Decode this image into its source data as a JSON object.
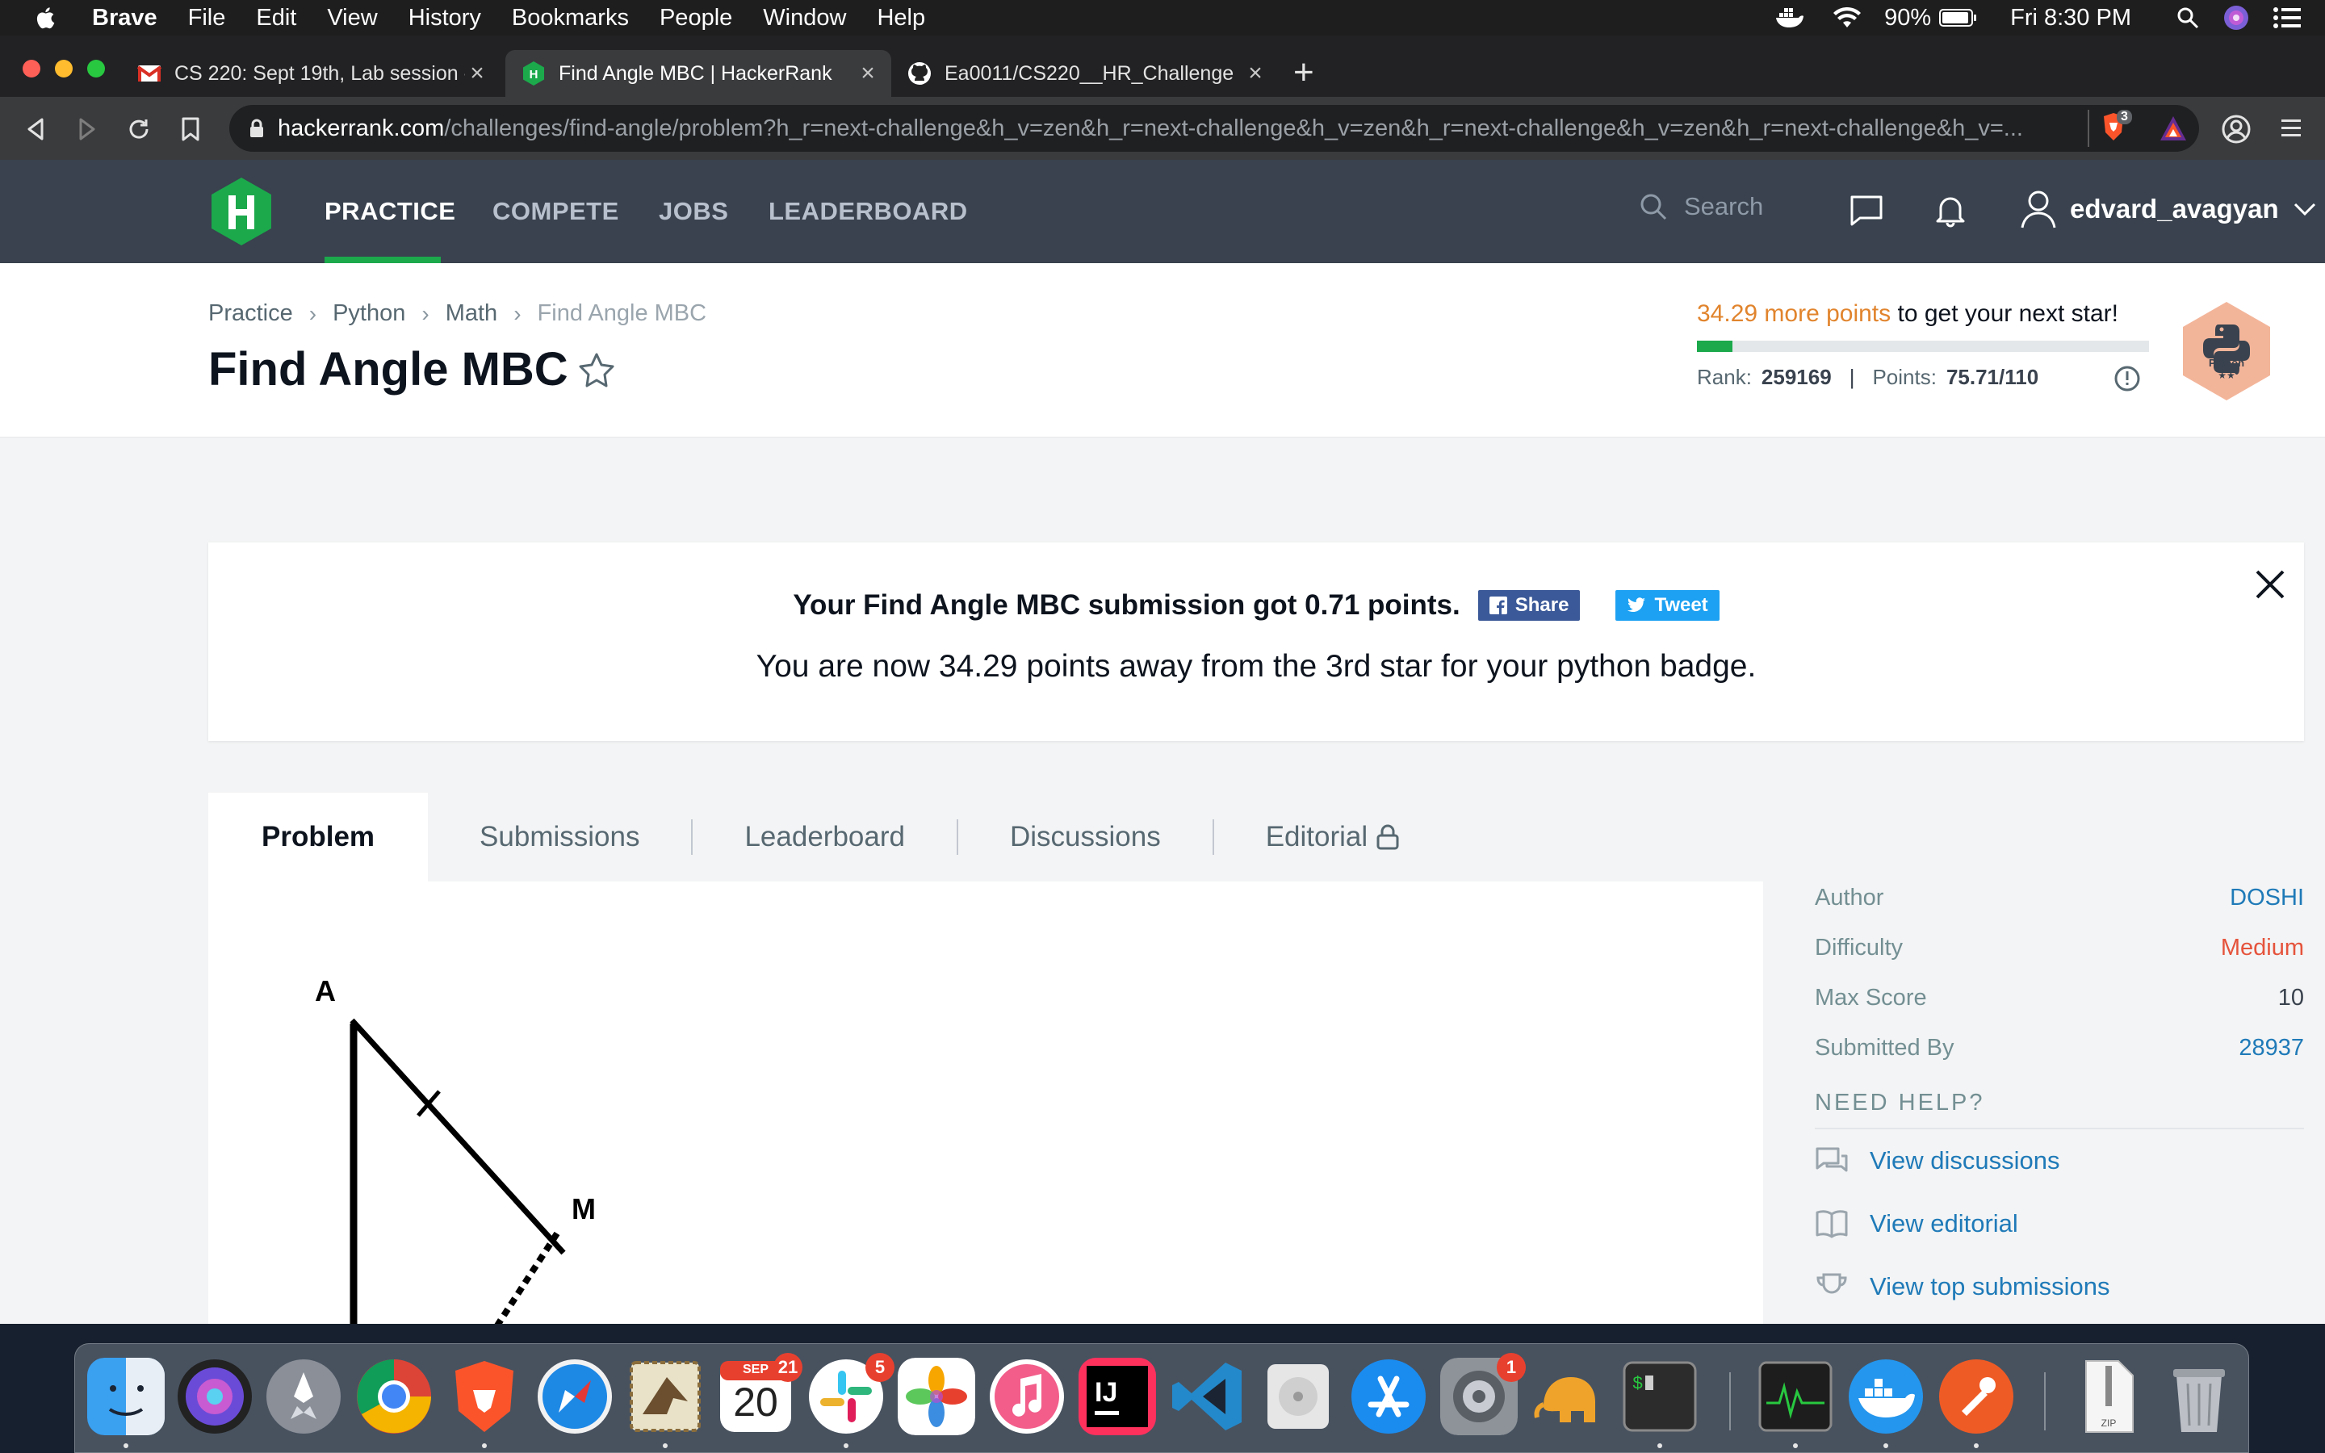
{
  "menubar": {
    "app": "Brave",
    "items": [
      "File",
      "Edit",
      "View",
      "History",
      "Bookmarks",
      "People",
      "Window",
      "Help"
    ],
    "battery": "90%",
    "clock": "Fri 8:30 PM"
  },
  "browser": {
    "tabs": [
      {
        "title": "CS 220: Sept 19th, Lab session -",
        "favicon": "gmail-icon"
      },
      {
        "title": "Find Angle MBC | HackerRank",
        "favicon": "hackerrank-icon"
      },
      {
        "title": "Ea0011/CS220__HR_Challenge",
        "favicon": "github-icon"
      }
    ],
    "url_host": "hackerrank.com",
    "url_path": "/challenges/find-angle/problem?h_r=next-challenge&h_v=zen&h_r=next-challenge&h_v=zen&h_r=next-challenge&h_v=zen&h_r=next-challenge&h_v=...",
    "brave_shield_count": "3"
  },
  "nav": {
    "links": [
      "PRACTICE",
      "COMPETE",
      "JOBS",
      "LEADERBOARD"
    ],
    "active": "PRACTICE",
    "search_placeholder": "Search",
    "username": "edvard_avagyan"
  },
  "header": {
    "breadcrumb": [
      "Practice",
      "Python",
      "Math",
      "Find Angle MBC"
    ],
    "title": "Find Angle MBC",
    "points_highlight": "34.29 more points",
    "points_rest": " to get your next star!",
    "progress": 0.0792,
    "rank_label": "Rank:",
    "rank_value": "259169",
    "points_label": "Points:",
    "points_value": "75.71/110",
    "badge_label": "Python",
    "badge_stars": "★★"
  },
  "banner": {
    "message": "Your Find Angle MBC submission got 0.71 points.",
    "share_label": "Share",
    "tweet_label": "Tweet",
    "detail": "You are now 34.29 points away from the 3rd star for your python badge."
  },
  "tabs": [
    "Problem",
    "Submissions",
    "Leaderboard",
    "Discussions",
    "Editorial"
  ],
  "diagram": {
    "labels": [
      "A",
      "M"
    ]
  },
  "sidebar": {
    "rows": [
      {
        "key": "Author",
        "value": "DOSHI"
      },
      {
        "key": "Difficulty",
        "value": "Medium"
      },
      {
        "key": "Max Score",
        "value": "10"
      },
      {
        "key": "Submitted By",
        "value": "28937"
      }
    ],
    "need_help": "NEED HELP?",
    "help_links": [
      "View discussions",
      "View editorial",
      "View top submissions"
    ]
  },
  "dock": {
    "calendar_month": "SEP",
    "calendar_day": "20",
    "badges": {
      "calendar": "21",
      "slack": "5",
      "system_prefs": "1"
    },
    "zip_label": "ZIP"
  },
  "colors": {
    "hr_green": "#1ba94c",
    "hr_nav": "#39424e",
    "points_orange": "#e1842d",
    "difficulty_medium": "#e5533c",
    "link_blue": "#1f7ab8"
  }
}
